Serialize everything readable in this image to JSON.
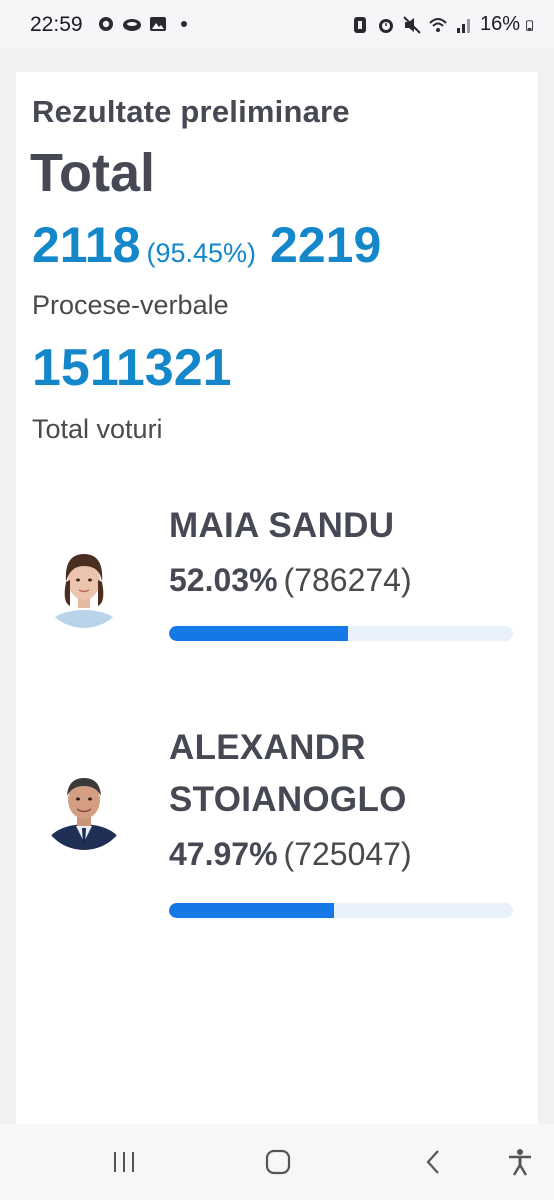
{
  "status_bar": {
    "time": "22:59",
    "battery": "16%",
    "left_icons": [
      "weather-icon",
      "cloud-icon",
      "gallery-icon",
      "dot-icon"
    ],
    "right_icons": [
      "nfc-icon",
      "alarm-icon",
      "mute-icon",
      "wifi-icon",
      "signal-icon",
      "battery-icon"
    ]
  },
  "header": {
    "subtitle": "Rezultate preliminare",
    "title": "Total"
  },
  "stats": {
    "processed": "2118",
    "processed_pct": "(95.45%)",
    "total_protocols": "2219",
    "protocols_label": "Procese-verbale",
    "total_votes": "1511321",
    "votes_label": "Total voturi"
  },
  "candidates": [
    {
      "name": "MAIA SANDU",
      "percent": "52.03%",
      "votes": "(786274)",
      "share": 0.5203
    },
    {
      "name": "ALEXANDR STOIANOGLO",
      "percent": "47.97%",
      "votes": "(725047)",
      "share": 0.4797
    }
  ],
  "colors": {
    "accent_blue": "#1387c9",
    "bar_fill": "#1478e6",
    "bar_track": "#e9f1fb",
    "text_dark": "#464854"
  },
  "nav": {
    "buttons": [
      "recents-icon",
      "home-icon",
      "back-icon",
      "accessibility-icon"
    ]
  }
}
